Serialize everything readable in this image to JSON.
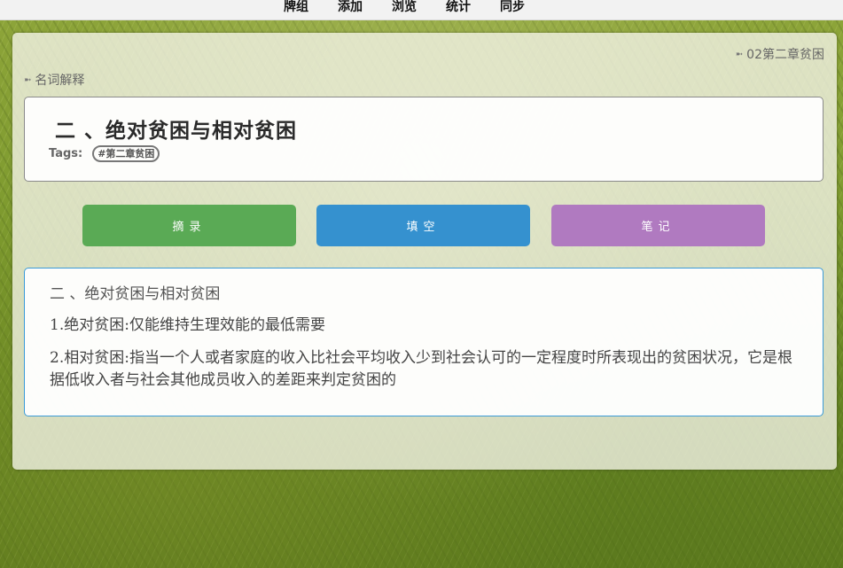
{
  "menu": [
    {
      "label": "牌组"
    },
    {
      "label": "添加"
    },
    {
      "label": "浏览"
    },
    {
      "label": "统计"
    },
    {
      "label": "同步"
    }
  ],
  "card": {
    "deck": "02第二章贫困",
    "note_type": "名词解释",
    "title": "二 、绝对贫困与相对贫困",
    "tags_label": "Tags:",
    "tags": [
      "#第二章贫困"
    ],
    "buttons": {
      "excerpt": "摘录",
      "cloze": "填空",
      "note": "笔记"
    },
    "content": [
      "二 、绝对贫困与相对贫困",
      "1.绝对贫困:仅能维持生理效能的最低需要",
      "2.相对贫困:指当一个人或者家庭的收入比社会平均收入少到社会认可的一定程度时所表现出的贫困状况，它是根据低收入者与社会其他成员收入的差距来判定贫困的"
    ]
  },
  "colors": {
    "excerpt": "#5aaa55",
    "cloze": "#3591cf",
    "note": "#b07ac0",
    "content_border": "#3a9ad8"
  },
  "icons": {
    "crumb_arrow": "arrow-icon"
  }
}
